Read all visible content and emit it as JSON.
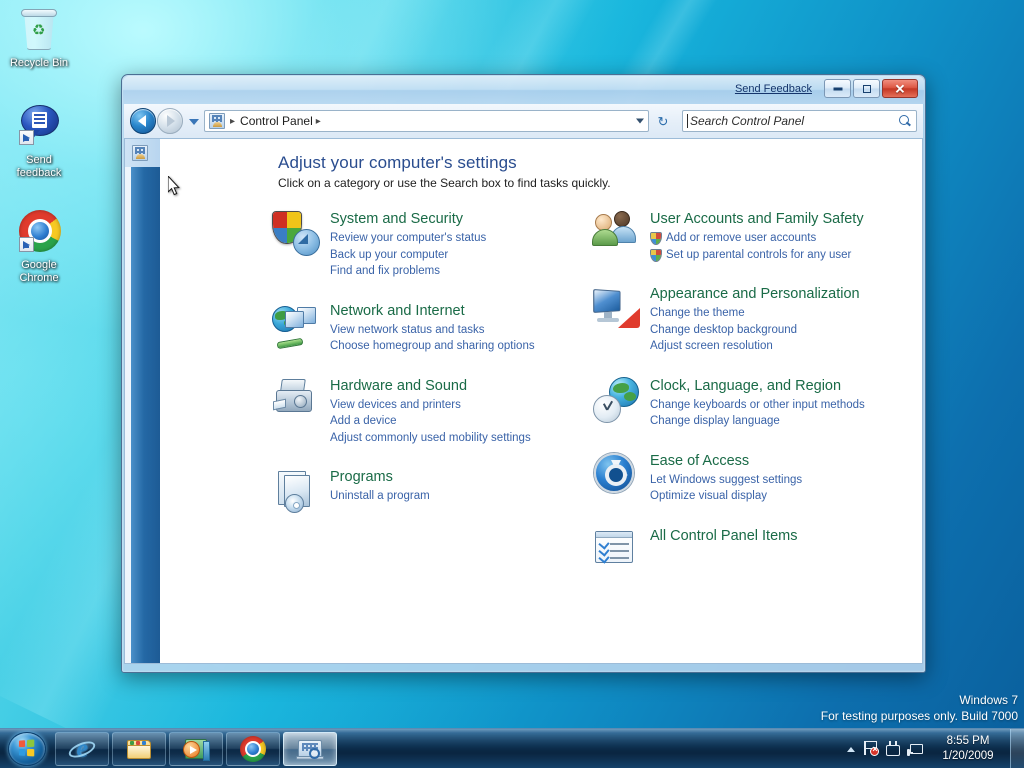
{
  "desktop": {
    "icons": [
      {
        "name": "Recycle Bin",
        "icon": "recycle-bin-icon",
        "shortcut": false
      },
      {
        "name": "Send\nfeedback",
        "label_line1": "Send",
        "label_line2": "feedback",
        "icon": "send-feedback-icon",
        "shortcut": true
      },
      {
        "name": "Google Chrome",
        "label_line1": "Google",
        "label_line2": "Chrome",
        "icon": "google-chrome-icon",
        "shortcut": true
      }
    ],
    "watermark": {
      "line1": "Windows 7",
      "line2": "For testing purposes only. Build 7000"
    }
  },
  "window": {
    "title_bar": {
      "send_feedback_label": "Send Feedback",
      "minimize_label": "",
      "maximize_label": "",
      "close_label": "✕"
    },
    "address_bar": {
      "crumb": "Control Panel",
      "crumb_sep": "▸",
      "leading_sep": "▸",
      "refresh_glyph": "↻"
    },
    "search": {
      "placeholder": "Search Control Panel"
    },
    "content": {
      "heading": "Adjust your computer's settings",
      "subheading": "Click on a category or use the Search box to find tasks quickly.",
      "categories_left": [
        {
          "title": "System and Security",
          "icon": "system-and-security-icon",
          "links": [
            {
              "text": "Review your computer's status",
              "shield": false
            },
            {
              "text": "Back up your computer",
              "shield": false
            },
            {
              "text": "Find and fix problems",
              "shield": false
            }
          ]
        },
        {
          "title": "Network and Internet",
          "icon": "network-and-internet-icon",
          "links": [
            {
              "text": "View network status and tasks",
              "shield": false
            },
            {
              "text": "Choose homegroup and sharing options",
              "shield": false
            }
          ]
        },
        {
          "title": "Hardware and Sound",
          "icon": "hardware-and-sound-icon",
          "links": [
            {
              "text": "View devices and printers",
              "shield": false
            },
            {
              "text": "Add a device",
              "shield": false
            },
            {
              "text": "Adjust commonly used mobility settings",
              "shield": false
            }
          ]
        },
        {
          "title": "Programs",
          "icon": "programs-icon",
          "links": [
            {
              "text": "Uninstall a program",
              "shield": false
            }
          ]
        }
      ],
      "categories_right": [
        {
          "title": "User Accounts and Family Safety",
          "icon": "user-accounts-icon",
          "links": [
            {
              "text": "Add or remove user accounts",
              "shield": true
            },
            {
              "text": "Set up parental controls for any user",
              "shield": true
            }
          ]
        },
        {
          "title": "Appearance and Personalization",
          "icon": "appearance-icon",
          "links": [
            {
              "text": "Change the theme",
              "shield": false
            },
            {
              "text": "Change desktop background",
              "shield": false
            },
            {
              "text": "Adjust screen resolution",
              "shield": false
            }
          ]
        },
        {
          "title": "Clock, Language, and Region",
          "icon": "clock-language-region-icon",
          "links": [
            {
              "text": "Change keyboards or other input methods",
              "shield": false
            },
            {
              "text": "Change display language",
              "shield": false
            }
          ]
        },
        {
          "title": "Ease of Access",
          "icon": "ease-of-access-icon",
          "links": [
            {
              "text": "Let Windows suggest settings",
              "shield": false
            },
            {
              "text": "Optimize visual display",
              "shield": false
            }
          ]
        },
        {
          "title": "All Control Panel Items",
          "icon": "all-control-panel-items-icon",
          "links": []
        }
      ]
    }
  },
  "taskbar": {
    "start_label": "Start",
    "buttons": [
      {
        "name": "internet-explorer",
        "active": false
      },
      {
        "name": "windows-explorer",
        "active": false
      },
      {
        "name": "windows-media-player",
        "active": false
      },
      {
        "name": "google-chrome",
        "active": false
      },
      {
        "name": "control-panel",
        "active": true
      }
    ],
    "tray": {
      "time": "8:55 PM",
      "date": "1/20/2009",
      "icons": [
        "action-center-flag-icon",
        "power-plug-icon",
        "network-icon"
      ]
    }
  }
}
